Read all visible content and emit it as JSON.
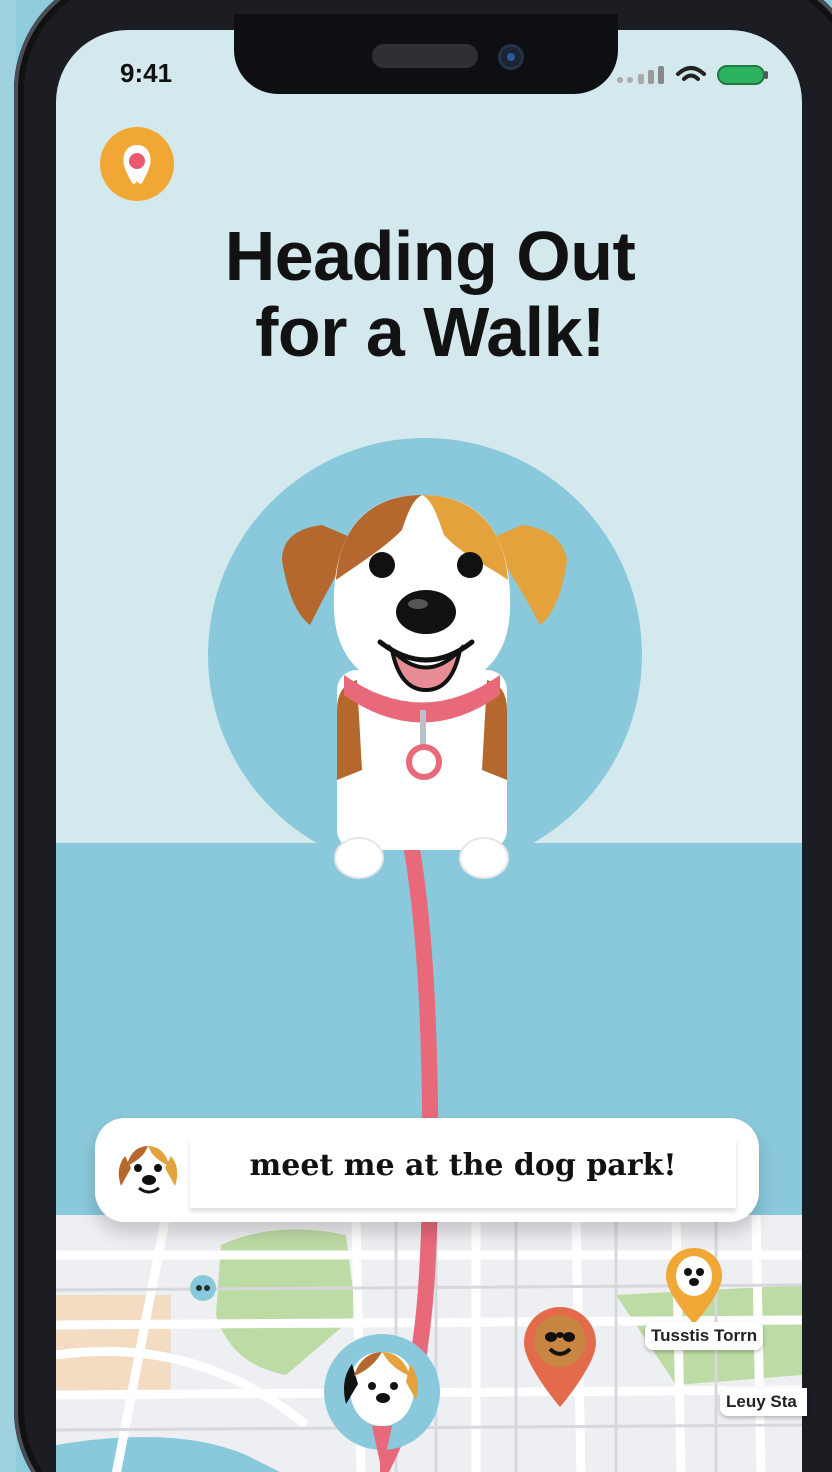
{
  "status_bar": {
    "time": "9:41",
    "signal_icon": "signal-bars-icon",
    "wifi_icon": "wifi-icon",
    "battery_icon": "battery-icon"
  },
  "header": {
    "badge_icon": "paw-heart-icon",
    "title_line1": "Heading Out",
    "title_line2": "for a Walk!"
  },
  "hero": {
    "illustration": "dog-with-leash-illustration"
  },
  "chat": {
    "avatar_icon": "dog-avatar-icon",
    "message": "meet me at the dog park!"
  },
  "map": {
    "pins": [
      {
        "label": "Tusstis Torrn",
        "icon": "dog-face-pin-icon"
      },
      {
        "label": "Leuy Sta",
        "icon": "map-pin-icon"
      }
    ],
    "current_location_icon": "dog-location-marker-icon"
  },
  "colors": {
    "background": "#d3e9ed",
    "accent_blue": "#8ac9db",
    "leash_pink": "#e8697a",
    "badge_orange": "#f0a735"
  }
}
